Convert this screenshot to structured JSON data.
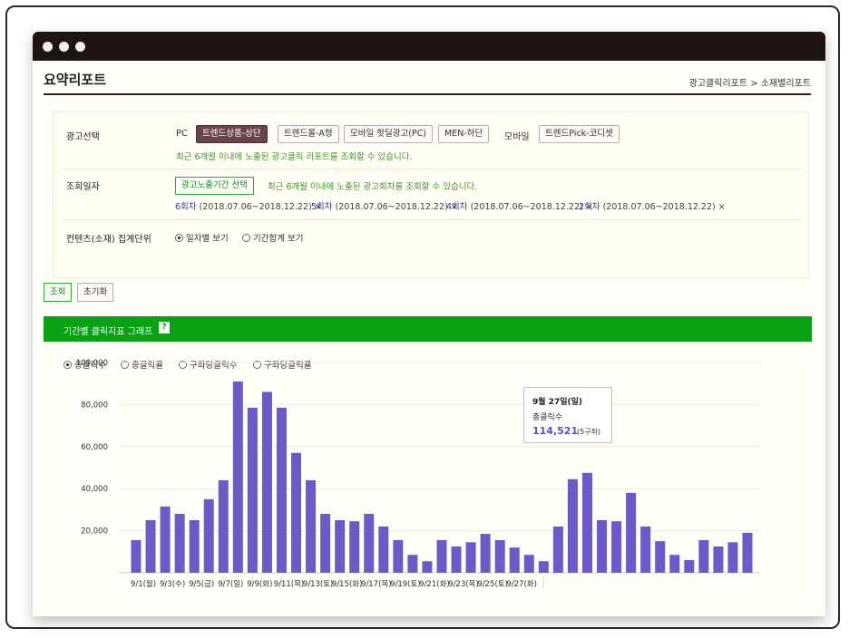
{
  "window": {
    "title_dots": 3
  },
  "page": {
    "title": "요약리포트",
    "breadcrumb": "광고클릭리포트 > 소재별리포트"
  },
  "filters": {
    "ad_select_label": "광고선택",
    "pc_label": "PC",
    "pc_buttons": [
      "트렌드상품-상단",
      "트렌드몰-A형",
      "모바일 핫딜광고(PC)",
      "MEN-하단"
    ],
    "mobile_label": "모바일",
    "mobile_buttons": [
      "트렌드Pick-코디셋"
    ],
    "ad_notice": "최근 6개월 이내에 노출된 광고클릭 리포트를 조회할 수 있습니다.",
    "date_label": "조회일자",
    "period_button": "광고노출기간 선택",
    "period_notice": "최근 6개월 이내에 노출된 광고회차를 조회할 수 있습니다.",
    "sessions": [
      {
        "num": "6회차",
        "range": "(2018.07.06~2018.12.22)",
        "remove": "×"
      },
      {
        "num": "5회차",
        "range": "(2018.07.06~2018.12.22)",
        "remove": "×"
      },
      {
        "num": "4회차",
        "range": "(2018.07.06~2018.12.22)",
        "remove": "×"
      },
      {
        "num": "2회차",
        "range": "(2018.07.06~2018.12.22)",
        "remove": "×"
      }
    ],
    "unit_label": "컨텐츠(소재) 집계단위",
    "unit_options": [
      {
        "label": "일자별 보기",
        "checked": true
      },
      {
        "label": "기간합계 보기",
        "checked": false
      }
    ]
  },
  "actions": {
    "search": "조회",
    "reset": "초기화"
  },
  "graph": {
    "header": "기간별 클릭지표 그래프",
    "help": "?",
    "metric_options": [
      {
        "label": "총클릭수",
        "checked": true
      },
      {
        "label": "총클릭률",
        "checked": false
      },
      {
        "label": "구좌당클릭수",
        "checked": false
      },
      {
        "label": "구좌당클릭률",
        "checked": false
      }
    ]
  },
  "tooltip": {
    "date": "9월 27일(일)",
    "metric": "총클릭수",
    "value": "114,521",
    "slots": "(5구좌)"
  },
  "colors": {
    "accent": "#0aa214",
    "bar": "#6a5bc8",
    "selected_button": "#6a4446"
  },
  "chart_data": {
    "type": "bar",
    "ylim": [
      0,
      100000
    ],
    "yticks": [
      "100,000",
      "80,000",
      "60,000",
      "40,000",
      "20,000"
    ],
    "ytick_values": [
      100000,
      80000,
      60000,
      40000,
      20000
    ],
    "xtick_labels": [
      "9/1(월)",
      "9/3(수)",
      "9/5(금)",
      "9/7(일)",
      "9/9(화)",
      "9/11(목)",
      "9/13(토)",
      "9/15(화)",
      "9/17(목)",
      "9/19(토)",
      "9/21(화)",
      "9/23(목)",
      "9/25(토)",
      "9/27(화)"
    ],
    "values": [
      15500,
      25000,
      31500,
      28000,
      25000,
      35000,
      44000,
      91000,
      78500,
      86000,
      78500,
      57000,
      44000,
      28000,
      25000,
      24500,
      28000,
      22000,
      15500,
      8500,
      5500,
      15500,
      12500,
      14500,
      18500,
      15500,
      12000,
      8500,
      5500,
      22000,
      44500,
      47500,
      25000,
      24500,
      38000,
      22000,
      15000,
      8500,
      6000,
      15500,
      12500,
      14500,
      19000
    ],
    "grid": true,
    "legend": "none"
  }
}
